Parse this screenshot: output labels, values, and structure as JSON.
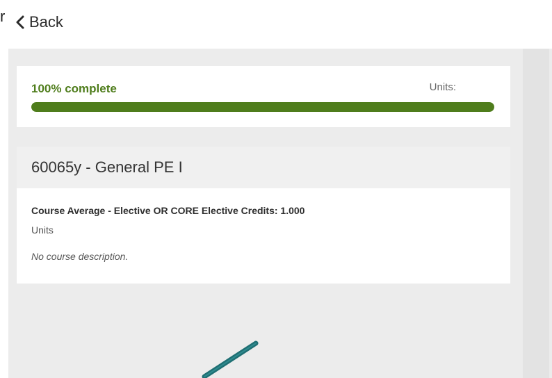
{
  "stray_char": "r",
  "nav": {
    "back_label": "Back"
  },
  "progress": {
    "label": "100% complete",
    "units_label": "Units:",
    "percent": 100
  },
  "course": {
    "title": "60065y - General PE I",
    "credits_line": "Course Average - Elective OR CORE Elective Credits: 1.000",
    "units_line": "Units",
    "description": "No course description."
  },
  "colors": {
    "accent_green": "#4f7d1c",
    "arrow_teal": "#1f6f73"
  },
  "icons": {
    "back": "chevron-left-icon",
    "annotation": "arrow-icon"
  }
}
